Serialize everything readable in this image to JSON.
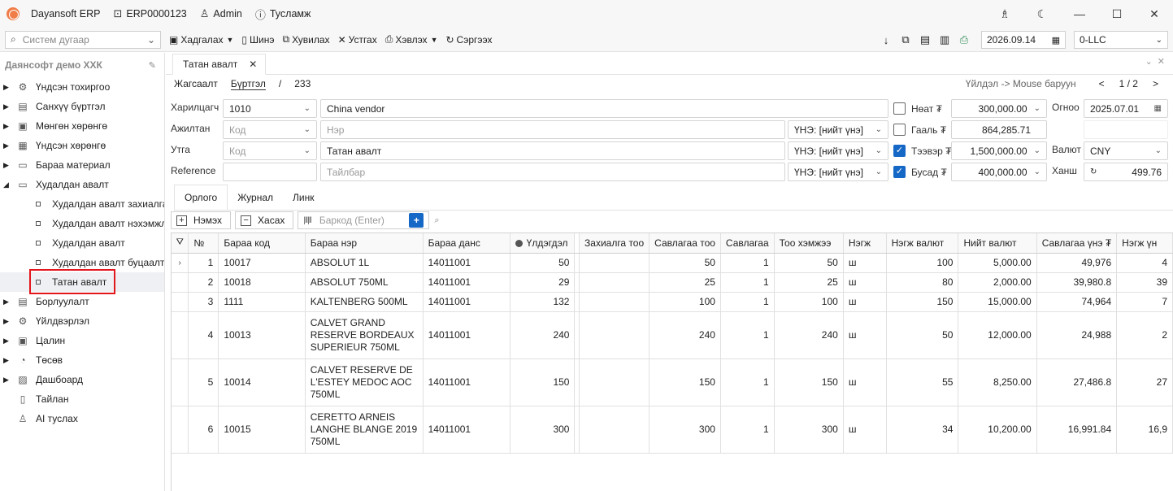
{
  "titlebar": {
    "app_name": "Dayansoft ERP",
    "db_code": "ERP0000123",
    "user": "Admin",
    "help": "Тусламж"
  },
  "toolbar": {
    "system_search_placeholder": "Систем дугаар",
    "save": "Хадгалах",
    "new": "Шинэ",
    "copy": "Хувилах",
    "delete": "Устгах",
    "print": "Хэвлэх",
    "refresh": "Сэргээх",
    "work_date": "2026.09.14",
    "company": "0-LLC"
  },
  "sidebar": {
    "company_name": "Даянсофт демо ХХК",
    "items": [
      {
        "label": "Үндсэн тохиргоо",
        "icon": "gear-icon"
      },
      {
        "label": "Санхүү бүртгэл",
        "icon": "finance-icon"
      },
      {
        "label": "Мөнгөн хөрөнгө",
        "icon": "cash-icon"
      },
      {
        "label": "Үндсэн хөрөнгө",
        "icon": "building-icon"
      },
      {
        "label": "Бараа материал",
        "icon": "box-icon"
      },
      {
        "label": "Худалдан авалт",
        "icon": "cart-icon"
      }
    ],
    "purchase_sub": [
      "Худалдан авалт захиалга",
      "Худалдан авалт нэхэмжлэх",
      "Худалдан авалт",
      "Худалдан авалт буцаалт",
      "Татан авалт"
    ],
    "items_after": [
      {
        "label": "Борлуулалт",
        "icon": "sales-icon"
      },
      {
        "label": "Үйлдвэрлэл",
        "icon": "factory-icon"
      },
      {
        "label": "Цалин",
        "icon": "salary-icon"
      },
      {
        "label": "Төсөв",
        "icon": "pie-chart-icon"
      },
      {
        "label": "Дашбоард",
        "icon": "dashboard-icon"
      },
      {
        "label": "Тайлан",
        "icon": "report-icon"
      },
      {
        "label": "AI туслах",
        "icon": "ai-assistant-icon"
      }
    ]
  },
  "document": {
    "tab_title": "Татан авалт",
    "crumb_list": "Жагсаалт",
    "crumb_register": "Бүртгэл",
    "crumb_sep": "/",
    "doc_number": "233",
    "hint": "Үйлдэл -> Mouse баруун",
    "page": "1 / 2",
    "prev": "<",
    "next": ">"
  },
  "form": {
    "customer_label": "Харилцагч",
    "customer_code": "1010",
    "customer_name": "China vendor",
    "employee_label": "Ажилтан",
    "employee_code_ph": "Код",
    "employee_name_ph": "Нэр",
    "line_label": "Утга",
    "line_code_ph": "Код",
    "line_value": "Татан авалт",
    "reference_label": "Reference",
    "note_ph": "Тайлбар",
    "price_type_1": "ҮНЭ: [нийт үнэ]",
    "price_type_2": "ҮНЭ: [нийт үнэ]",
    "price_type_3": "ҮНЭ: [нийт үнэ]",
    "vat_label": "Нөат ₮",
    "vat_value": "300,000.00",
    "customs_label": "Гааль ₮",
    "customs_value": "864,285.71",
    "transport_label": "Тээвэр ₮",
    "transport_value": "1,500,000.00",
    "other_label": "Бусад ₮",
    "other_value": "400,000.00",
    "date_label": "Огноо",
    "date_value": "2025.07.01",
    "currency_label": "Валют",
    "currency_value": "CNY",
    "rate_label": "Ханш",
    "rate_value": "499.76"
  },
  "subtabs": [
    "Орлого",
    "Журнал",
    "Линк"
  ],
  "gridbar": {
    "add": "Нэмэх",
    "remove": "Хасах",
    "barcode_ph": "Баркод (Enter)"
  },
  "grid": {
    "columns": [
      "№",
      "Бараа код",
      "Бараа нэр",
      "Бараа данс",
      "Үлдэгдэл",
      "Захиалга тоо",
      "Савлагаа тоо",
      "Савлагаа",
      "Тоо хэмжээ",
      "Нэгж",
      "Нэгж валют",
      "Нийт валют",
      "Савлагаа үнэ ₮",
      "Нэгж үн"
    ],
    "rows": [
      {
        "no": "1",
        "code": "10017",
        "name": "ABSOLUT 1L",
        "account": "14011001",
        "balance": "50",
        "order_qty": "",
        "pack_qty": "50",
        "pack": "1",
        "qty": "50",
        "unit": "ш",
        "unit_cur": "100",
        "total_cur": "5,000.00",
        "pack_price": "49,976",
        "unit_price": "4"
      },
      {
        "no": "2",
        "code": "10018",
        "name": "ABSOLUT 750ML",
        "account": "14011001",
        "balance": "29",
        "order_qty": "",
        "pack_qty": "25",
        "pack": "1",
        "qty": "25",
        "unit": "ш",
        "unit_cur": "80",
        "total_cur": "2,000.00",
        "pack_price": "39,980.8",
        "unit_price": "39"
      },
      {
        "no": "3",
        "code": "1111",
        "name": "KALTENBERG 500ML",
        "account": "14011001",
        "balance": "132",
        "order_qty": "",
        "pack_qty": "100",
        "pack": "1",
        "qty": "100",
        "unit": "ш",
        "unit_cur": "150",
        "total_cur": "15,000.00",
        "pack_price": "74,964",
        "unit_price": "7"
      },
      {
        "no": "4",
        "code": "10013",
        "name": "CALVET GRAND RESERVE BORDEAUX SUPERIEUR 750ML",
        "account": "14011001",
        "balance": "240",
        "order_qty": "",
        "pack_qty": "240",
        "pack": "1",
        "qty": "240",
        "unit": "ш",
        "unit_cur": "50",
        "total_cur": "12,000.00",
        "pack_price": "24,988",
        "unit_price": "2"
      },
      {
        "no": "5",
        "code": "10014",
        "name": "CALVET RESERVE DE L'ESTEY MEDOC AOC 750ML",
        "account": "14011001",
        "balance": "150",
        "order_qty": "",
        "pack_qty": "150",
        "pack": "1",
        "qty": "150",
        "unit": "ш",
        "unit_cur": "55",
        "total_cur": "8,250.00",
        "pack_price": "27,486.8",
        "unit_price": "27"
      },
      {
        "no": "6",
        "code": "10015",
        "name": "CERETTO ARNEIS LANGHE BLANGE 2019 750ML",
        "account": "14011001",
        "balance": "300",
        "order_qty": "",
        "pack_qty": "300",
        "pack": "1",
        "qty": "300",
        "unit": "ш",
        "unit_cur": "34",
        "total_cur": "10,200.00",
        "pack_price": "16,991.84",
        "unit_price": "16,9"
      }
    ]
  },
  "colors": {
    "accent": "#1668c6",
    "highlight_border": "#e3161c",
    "logo": "#f07d48"
  }
}
